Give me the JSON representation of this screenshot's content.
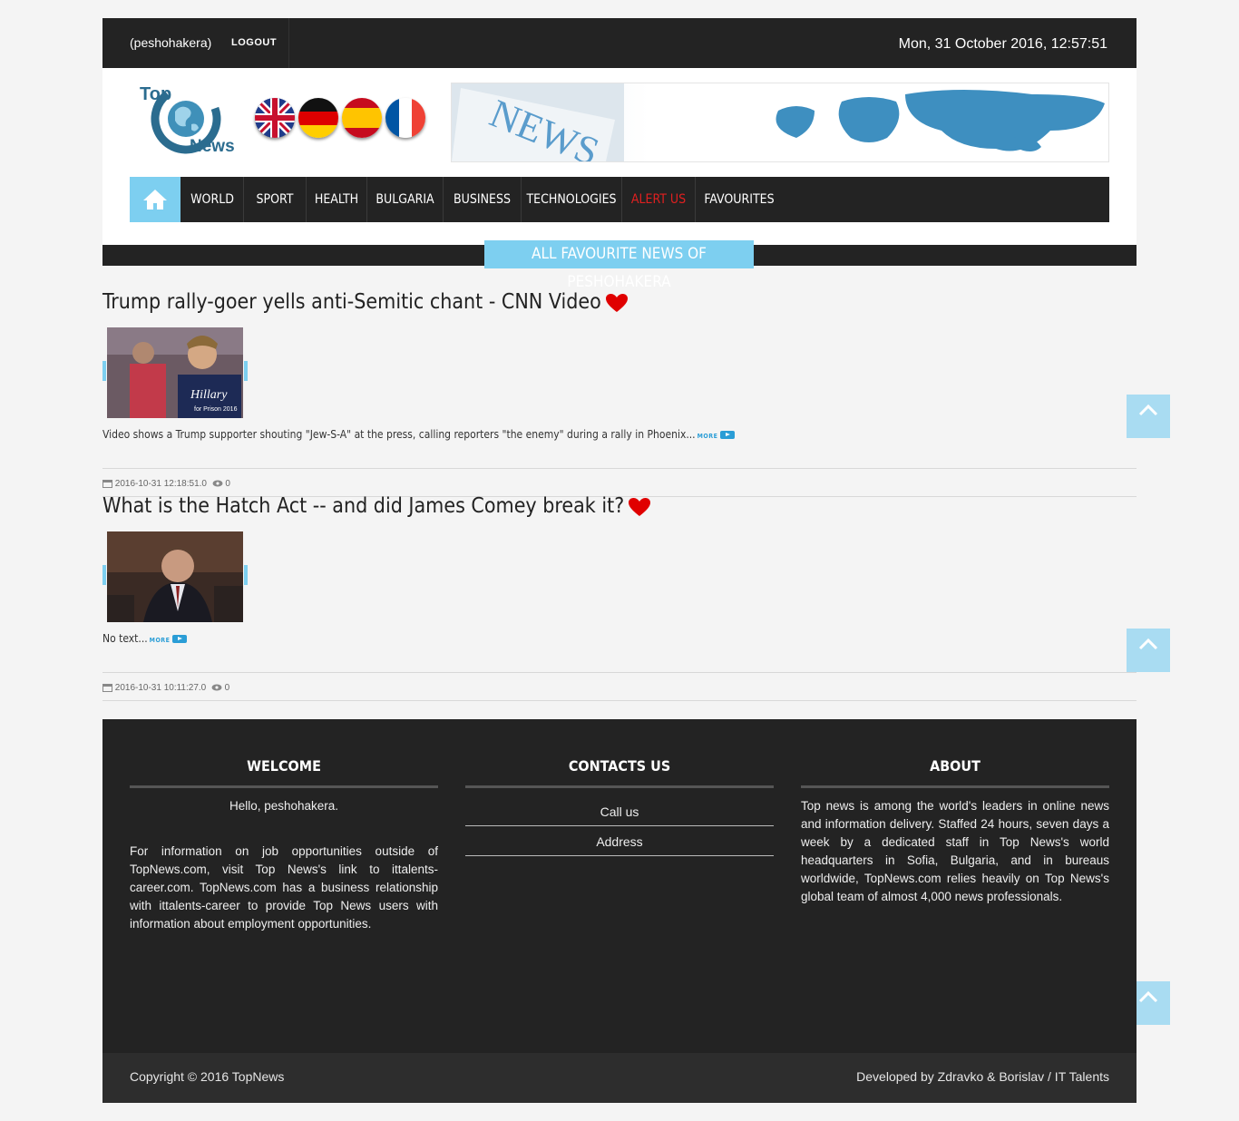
{
  "topbar": {
    "user": "(peshohakera)",
    "logout": "LOGOUT",
    "datetime": "Mon, 31 October 2016, 12:57:51"
  },
  "logo": {
    "line1": "Top",
    "line2": "News"
  },
  "languages": [
    "uk-flag-icon",
    "germany-flag-icon",
    "spain-flag-icon",
    "france-flag-icon"
  ],
  "nav": {
    "home_icon": "home-icon",
    "items": [
      "WORLD",
      "SPORT",
      "HEALTH",
      "BULGARIA",
      "BUSINESS",
      "TECHNOLOGIES",
      "ALERT US",
      "FAVOURITES"
    ]
  },
  "section": {
    "title": "ALL FAVOURITE NEWS OF PESHOHAKERA"
  },
  "articles": [
    {
      "title": "Trump rally-goer yells anti-Semitic chant - CNN Video",
      "text": "Video shows a Trump supporter shouting \"Jew-S-A\" at the press, calling reporters \"the enemy\" during a rally in Phoenix...",
      "more": "MORE",
      "date": "2016-10-31 12:18:51.0",
      "views": "0"
    },
    {
      "title": "What is the Hatch Act -- and did James Comey break it?",
      "text": "No text...",
      "more": "MORE",
      "date": "2016-10-31 10:11:27.0",
      "views": "0"
    }
  ],
  "footer": {
    "welcome": {
      "title": "WELCOME",
      "greeting": "Hello, peshohakera.",
      "text": "For information on job opportunities outside of TopNews.com, visit Top News's link to ittalents-career.com. TopNews.com has a business relationship with ittalents-career to provide Top News users with information about employment opportunities."
    },
    "contacts": {
      "title": "CONTACTS US",
      "items": [
        "Call us",
        "Address"
      ]
    },
    "about": {
      "title": "ABOUT",
      "text": "Top news is among the world's leaders in online news and information delivery. Staffed 24 hours, seven days a week by a dedicated staff in Top News's world headquarters in Sofia, Bulgaria, and in bureaus worldwide, TopNews.com relies heavily on Top News's global team of almost 4,000 news professionals."
    },
    "copyright": "Copyright © 2016 TopNews",
    "developer": "Developed by Zdravko & Borislav / IT Talents"
  },
  "colors": {
    "accent": "#7dcff0",
    "dark": "#232323",
    "alert": "#e02020",
    "heart": "#e00000"
  }
}
